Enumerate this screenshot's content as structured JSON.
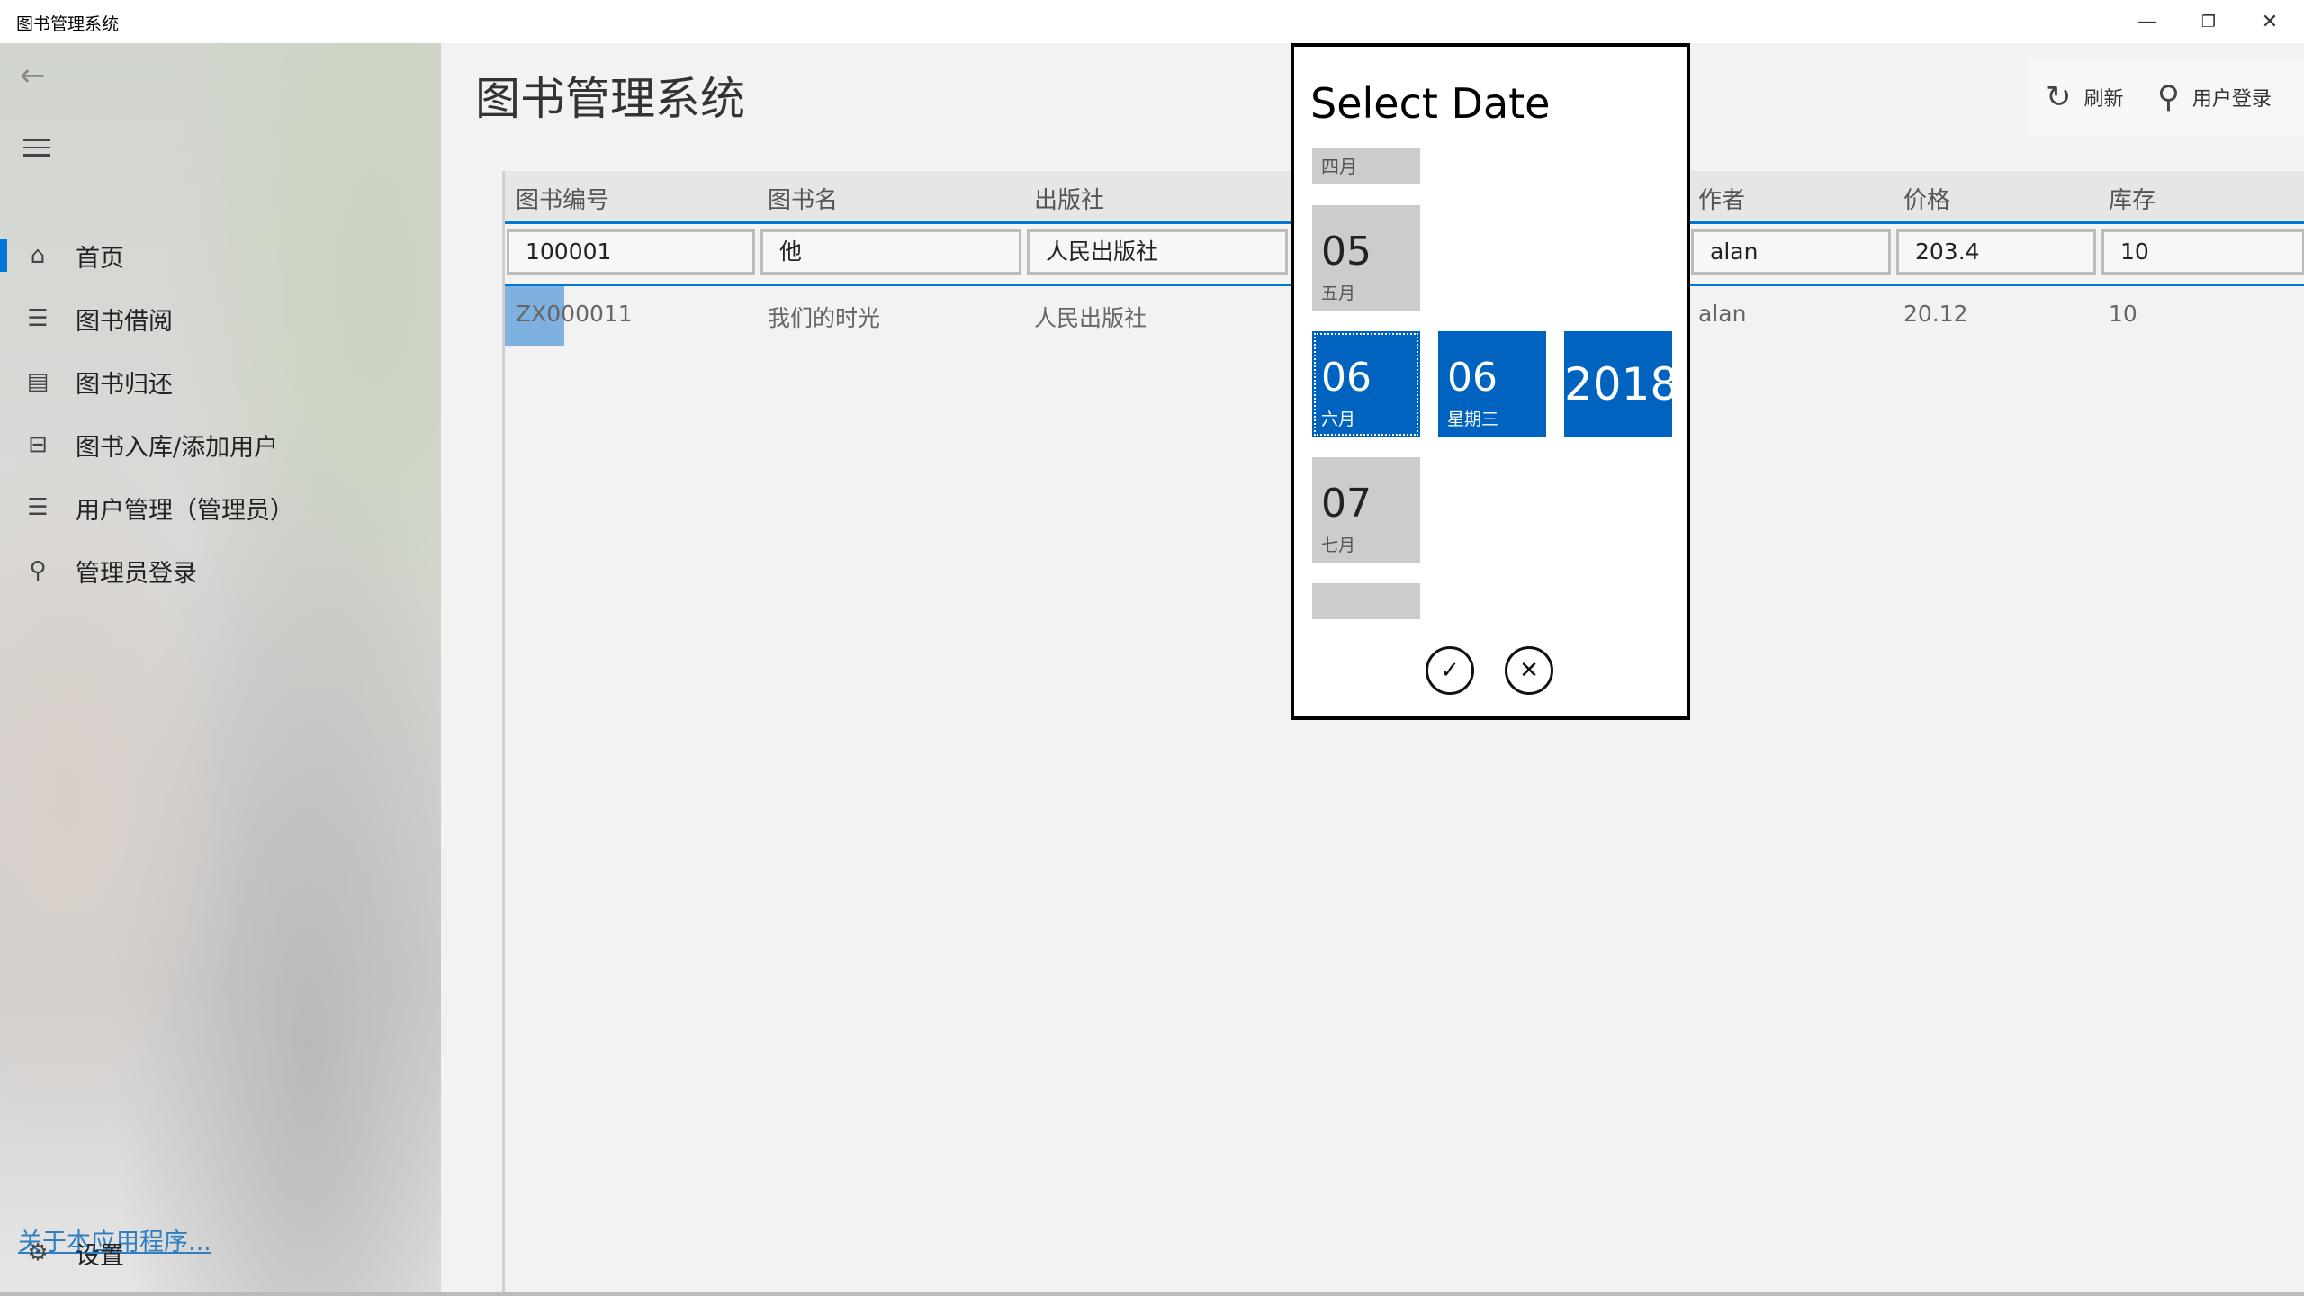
{
  "window": {
    "title": "图书管理系统",
    "minimize": "—",
    "restore": "❐",
    "close": "✕"
  },
  "nav": {
    "items": [
      {
        "label": "首页",
        "icon": "⌂",
        "selected": true
      },
      {
        "label": "图书借阅",
        "icon": "☰",
        "selected": false
      },
      {
        "label": "图书归还",
        "icon": "▤",
        "selected": false
      },
      {
        "label": "图书入库/添加用户",
        "icon": "⊟",
        "selected": false
      },
      {
        "label": "用户管理（管理员）",
        "icon": "☰",
        "selected": false
      },
      {
        "label": "管理员登录",
        "icon": "⚲",
        "selected": false
      }
    ],
    "about": "关于本应用程序...",
    "settings": {
      "label": "设置",
      "icon": "⚙"
    }
  },
  "main": {
    "title": "图书管理系统",
    "commands": {
      "refresh": "刷新",
      "login": "用户登录"
    }
  },
  "grid": {
    "columns": [
      "图书编号",
      "图书名",
      "出版社",
      "作者",
      "价格",
      "库存"
    ],
    "edit_row": {
      "id": "100001",
      "name": "他",
      "publisher": "人民出版社",
      "author": "alan",
      "price": "203.4",
      "stock": "10"
    },
    "rows": [
      {
        "id": "ZX000011",
        "name": "我们的时光",
        "publisher": "人民出版社",
        "author": "alan",
        "price": "20.12",
        "stock": "10"
      }
    ]
  },
  "datepicker": {
    "title": "Select Date",
    "month_above_partial": "四月",
    "month_prev": {
      "num": "05",
      "name": "五月"
    },
    "month_sel": {
      "num": "06",
      "name": "六月"
    },
    "day_sel": {
      "num": "06",
      "name": "星期三"
    },
    "year_sel": "2018",
    "month_next": {
      "num": "07",
      "name": "七月"
    },
    "accept": "✓",
    "dismiss": "✕"
  },
  "colors": {
    "accent": "#0063bf",
    "selection": "#0078d7",
    "link": "#2f7ec2"
  }
}
